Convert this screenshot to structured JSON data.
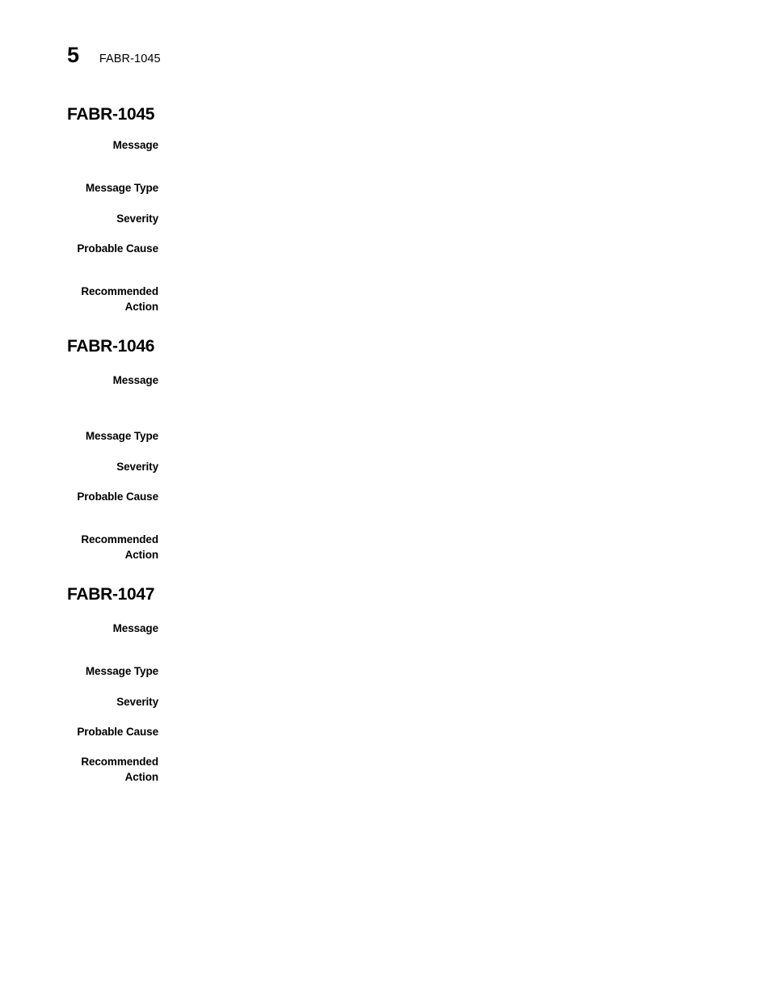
{
  "page": {
    "chapter_number": "5",
    "running_header_title": "FABR-1045"
  },
  "field_labels": {
    "message": "Message",
    "message_type": "Message Type",
    "severity": "Severity",
    "probable_cause": "Probable Cause",
    "recommended_action": "Recommended\nAction"
  },
  "sections": [
    {
      "heading": "FABR-1045",
      "fields": {
        "message": "",
        "message_type": "",
        "severity": "",
        "probable_cause": "",
        "recommended_action": ""
      }
    },
    {
      "heading": "FABR-1046",
      "fields": {
        "message": "",
        "message_type": "",
        "severity": "",
        "probable_cause": "",
        "recommended_action": ""
      }
    },
    {
      "heading": "FABR-1047",
      "fields": {
        "message": "",
        "message_type": "",
        "severity": "",
        "probable_cause": "",
        "recommended_action": ""
      }
    }
  ]
}
